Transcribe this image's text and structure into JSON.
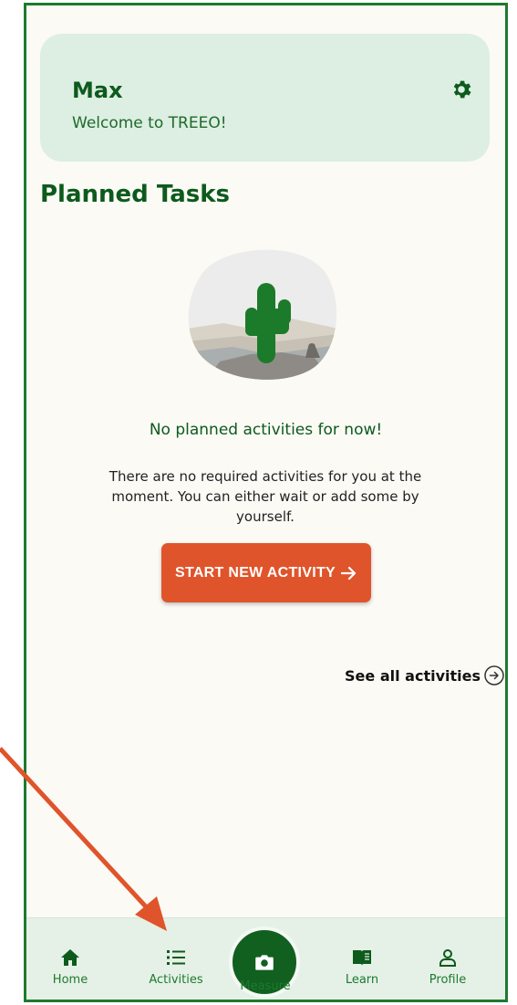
{
  "header": {
    "user_name": "Max",
    "welcome": "Welcome to TREEO!"
  },
  "planned": {
    "title": "Planned Tasks",
    "empty_title": "No planned activities for now!",
    "empty_desc_line1": "There are no required activities for you at the",
    "empty_desc_line2": "moment. You can either wait or add some by",
    "empty_desc_line3": "yourself.",
    "start_button": "START NEW ACTIVITY",
    "see_all": "See all activities"
  },
  "nav": {
    "items": [
      {
        "label": "Home",
        "icon": "home-icon"
      },
      {
        "label": "Activities",
        "icon": "list-icon"
      },
      {
        "label": "Measure",
        "icon": "camera-icon"
      },
      {
        "label": "Learn",
        "icon": "book-icon"
      },
      {
        "label": "Profile",
        "icon": "person-icon"
      }
    ]
  },
  "colors": {
    "brand_green": "#0d5a1d",
    "accent_orange": "#e0542b",
    "card_bg": "#ddeee2",
    "nav_bg": "#e5f1e7"
  }
}
